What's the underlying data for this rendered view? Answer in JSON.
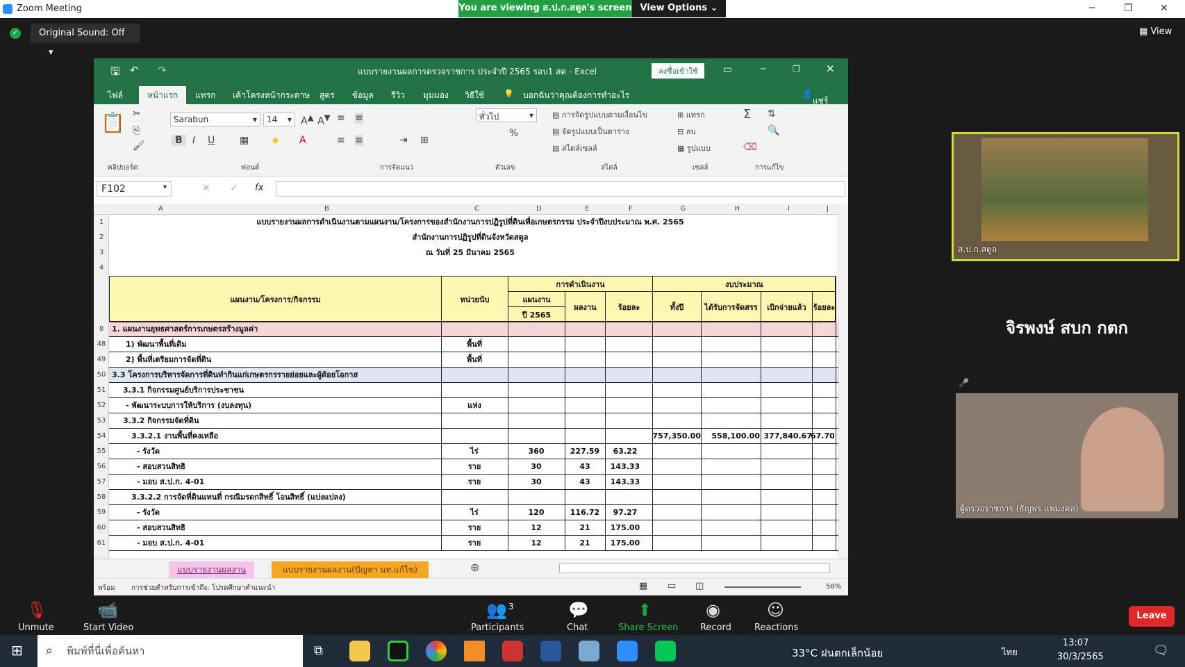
{
  "zoom": {
    "title": "Zoom Meeting",
    "viewing": "You are viewing ส.ป.ก.สตูล's screen",
    "view_options": "View Options",
    "original_sound": "Original Sound: Off",
    "view": "View"
  },
  "excel": {
    "title": "แบบรายงานผลการตรวจราชการ ประจำปี 2565 รอบ1 สต - Excel",
    "signin": "ลงชื่อเข้าใช้",
    "tabs": [
      "ไฟล์",
      "หน้าแรก",
      "แทรก",
      "เค้าโครงหน้ากระดาษ",
      "สูตร",
      "ข้อมูล",
      "รีวิว",
      "มุมมอง",
      "วิธีใช้"
    ],
    "tellme": "บอกฉันว่าคุณต้องการทำอะไร",
    "share": "แชร์",
    "font": "Sarabun",
    "size": "14",
    "number_format": "ทั่วไป",
    "ribbon": {
      "clipboard": "คลิปบอร์ด",
      "font": "ฟอนต์",
      "align": "การจัดแนว",
      "number": "ตัวเลข",
      "styles": "สไตล์",
      "cells": "เซลล์",
      "editing": "การแก้ไข",
      "cond": "การจัดรูปแบบตามเงื่อนไข",
      "table": "จัดรูปแบบเป็นตาราง",
      "cellstyle": "สไตล์เซลล์",
      "insert": "แทรก",
      "delete": "ลบ",
      "format": "รูปแบบ"
    },
    "namebox": "F102",
    "columns": [
      "A",
      "B",
      "C",
      "D",
      "E",
      "F",
      "G",
      "H",
      "I",
      "J"
    ],
    "rows": [
      {
        "n": "1",
        "b": "แบบรายงานผลการดำเนินงานตามแผนงาน/โครงการของสำนักงานการปฏิรูปที่ดินเพื่อเกษตรกรรม ประจำปีงบประมาณ พ.ศ. 2565"
      },
      {
        "n": "2",
        "b": "สำนักงานการปฏิรูปที่ดินจังหวัดสตูล"
      },
      {
        "n": "3",
        "b": "ณ วันที่ 25 มีนาคม 2565"
      },
      {
        "n": "4",
        "b": ""
      },
      {
        "n": "8",
        "b": "1. แผนงานยุทธศาสตร์การเกษตรสร้างมูลค่า"
      },
      {
        "n": "48",
        "b": "1) พัฒนาพื้นที่เดิม",
        "c": "พื้นที่"
      },
      {
        "n": "49",
        "b": "2) พื้นที่เตรียมการจัดที่ดิน",
        "c": "พื้นที่"
      },
      {
        "n": "50",
        "b": "3.3  โครงการบริหารจัดการที่ดินทำกินแก่เกษตรกรรายย่อยและผู้ด้อยโอกาส"
      },
      {
        "n": "51",
        "b": "3.3.1 กิจกรรมศูนย์บริการประชาชน"
      },
      {
        "n": "52",
        "b": "- พัฒนาระบบการให้บริการ (งบลงทุน)",
        "c": "แห่ง"
      },
      {
        "n": "53",
        "b": "3.3.2 กิจกรรมจัดที่ดิน"
      },
      {
        "n": "54",
        "b": "3.3.2.1 งานพื้นที่คงเหลือ",
        "g": "757,350.00",
        "h": "558,100.00",
        "i": "377,840.67",
        "j": "67.70"
      },
      {
        "n": "55",
        "b": "- รังวัด",
        "c": "ไร่",
        "d": "360",
        "e": "227.59",
        "f": "63.22"
      },
      {
        "n": "56",
        "b": "- สอบสวนสิทธิ",
        "c": "ราย",
        "d": "30",
        "e": "43",
        "f": "143.33"
      },
      {
        "n": "57",
        "b": "- มอบ ส.ป.ก. 4-01",
        "c": "ราย",
        "d": "30",
        "e": "43",
        "f": "143.33"
      },
      {
        "n": "58",
        "b": "3.3.2.2 การจัดที่ดินแทนที่ กรณีมรดกสิทธิ์ โอนสิทธิ์ (แบ่งแปลง)"
      },
      {
        "n": "59",
        "b": "- รังวัด",
        "c": "ไร่",
        "d": "120",
        "e": "116.72",
        "f": "97.27"
      },
      {
        "n": "60",
        "b": "- สอบสวนสิทธิ",
        "c": "ราย",
        "d": "12",
        "e": "21",
        "f": "175.00"
      },
      {
        "n": "61",
        "b": "- มอบ ส.ป.ก. 4-01",
        "c": "ราย",
        "d": "12",
        "e": "21",
        "f": "175.00"
      }
    ],
    "header": {
      "plan": "แผนงาน/โครงการ/กิจกรรม",
      "unit": "หน่วยนับ",
      "op": "การดำเนินงาน",
      "budget": "งบประมาณ",
      "plan65": "แผนงาน",
      "plan65b": "ปี 2565",
      "result": "ผลงาน",
      "pct": "ร้อยละ",
      "year": "ทั้งปี",
      "alloc": "ได้รับการจัดสรร",
      "spent": "เบิกจ่ายแล้ว",
      "pct2": "ร้อยละ"
    },
    "sheets": [
      "แบบรายงานผลงาน",
      "แบบรายงานผลงาน(ปัญหา นท.แก้ไข)"
    ],
    "status": "พร้อม",
    "status2": "การช่วยสำหรับการเข้าถึง: โปรดศึกษาคำแนะนำ",
    "zoom": "58%"
  },
  "participants": {
    "p1": "ส.ป.ก.สตูล",
    "p2_name": "จิรพงษ์ สบก กตก",
    "p3": "ผู้ตรวจราชการ (ธัญพร แพมงคล)"
  },
  "toolbar": {
    "unmute": "Unmute",
    "video": "Start Video",
    "participants": "Participants",
    "count": "3",
    "chat": "Chat",
    "share": "Share Screen",
    "record": "Record",
    "reactions": "Reactions",
    "leave": "Leave"
  },
  "taskbar": {
    "search": "พิมพ์ที่นี่เพื่อค้นหา",
    "weather": "33°C  ฝนตกเล็กน้อย",
    "lang": "ไทย",
    "time": "13:07",
    "date": "30/3/2565"
  }
}
